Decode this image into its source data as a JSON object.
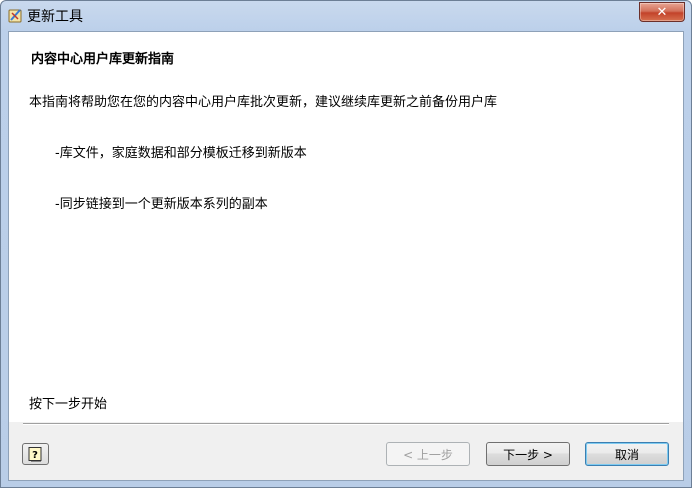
{
  "window": {
    "title": "更新工具",
    "close_glyph": "✕"
  },
  "content": {
    "heading": "内容中心用户库更新指南",
    "intro": "本指南将帮助您在您的内容中心用户库批次更新，建议继续库更新之前备份用户库",
    "bullet1": "-库文件，家庭数据和部分模板迁移到新版本",
    "bullet2": "-同步链接到一个更新版本系列的副本",
    "start_text": "按下一步开始"
  },
  "buttons": {
    "help_glyph": "?",
    "prev": "< 上一步",
    "next": "下一步 >",
    "cancel": "取消"
  }
}
